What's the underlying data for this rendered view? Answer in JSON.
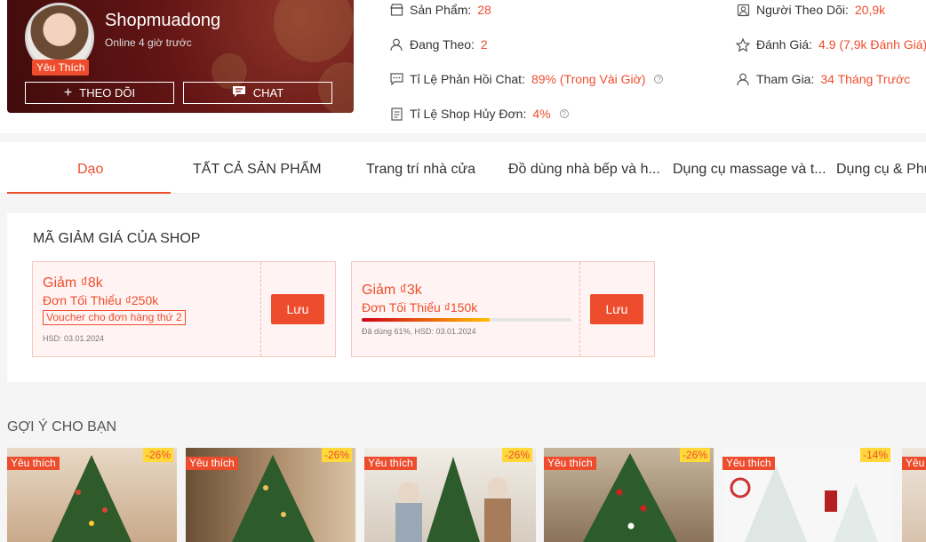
{
  "shop": {
    "name": "Shopmuadong",
    "online": "Online 4 giờ trước",
    "badge": "Yêu Thích",
    "follow_label": "THEO DÕI",
    "chat_label": "CHAT"
  },
  "stats": {
    "products_label": "Sản Phẩm:",
    "products_value": "28",
    "following_label": "Đang Theo:",
    "following_value": "2",
    "chat_rate_label": "Tỉ Lệ Phản Hồi Chat:",
    "chat_rate_value": "89% (Trong Vài Giờ)",
    "cancel_rate_label": "Tỉ Lệ Shop Hủy Đơn:",
    "cancel_rate_value": "4%",
    "followers_label": "Người Theo Dõi:",
    "followers_value": "20,9k",
    "rating_label": "Đánh Giá:",
    "rating_value": "4.9 (7,9k Đánh Giá)",
    "joined_label": "Tham Gia:",
    "joined_value": "34 Tháng Trước"
  },
  "tabs": [
    "Dạo",
    "TẤT CẢ SẢN PHẨM",
    "Trang trí nhà cửa",
    "Đồ dùng nhà bếp và h...",
    "Dụng cụ massage và t...",
    "Dụng cụ & Phụ"
  ],
  "vouchers": {
    "title": "MÃ GIẢM GIÁ CỦA SHOP",
    "items": [
      {
        "discount": "Giảm ₫8k",
        "min": "Đơn Tối Thiểu ₫250k",
        "tag": "Voucher cho đơn hàng thứ 2",
        "hsd": "HSD: 03.01.2024",
        "save": "Lưu"
      },
      {
        "discount": "Giảm ₫3k",
        "min": "Đơn Tối Thiểu ₫150k",
        "used": "Đã dùng 61%, HSD: 03.01.2024",
        "used_fraction": 0.61,
        "save": "Lưu"
      }
    ]
  },
  "suggest_title": "GỢI Ý CHO BẠN",
  "products": [
    {
      "tag": "Yêu thích",
      "discount": "-26%"
    },
    {
      "tag": "Yêu thích",
      "discount": "-26%"
    },
    {
      "tag": "Yêu thích",
      "discount": "-26%"
    },
    {
      "tag": "Yêu thích",
      "discount": "-26%"
    },
    {
      "tag": "Yêu thích",
      "discount": "-14%"
    },
    {
      "tag": "Yêu"
    }
  ],
  "colors": {
    "accent": "#ee4d2d"
  }
}
